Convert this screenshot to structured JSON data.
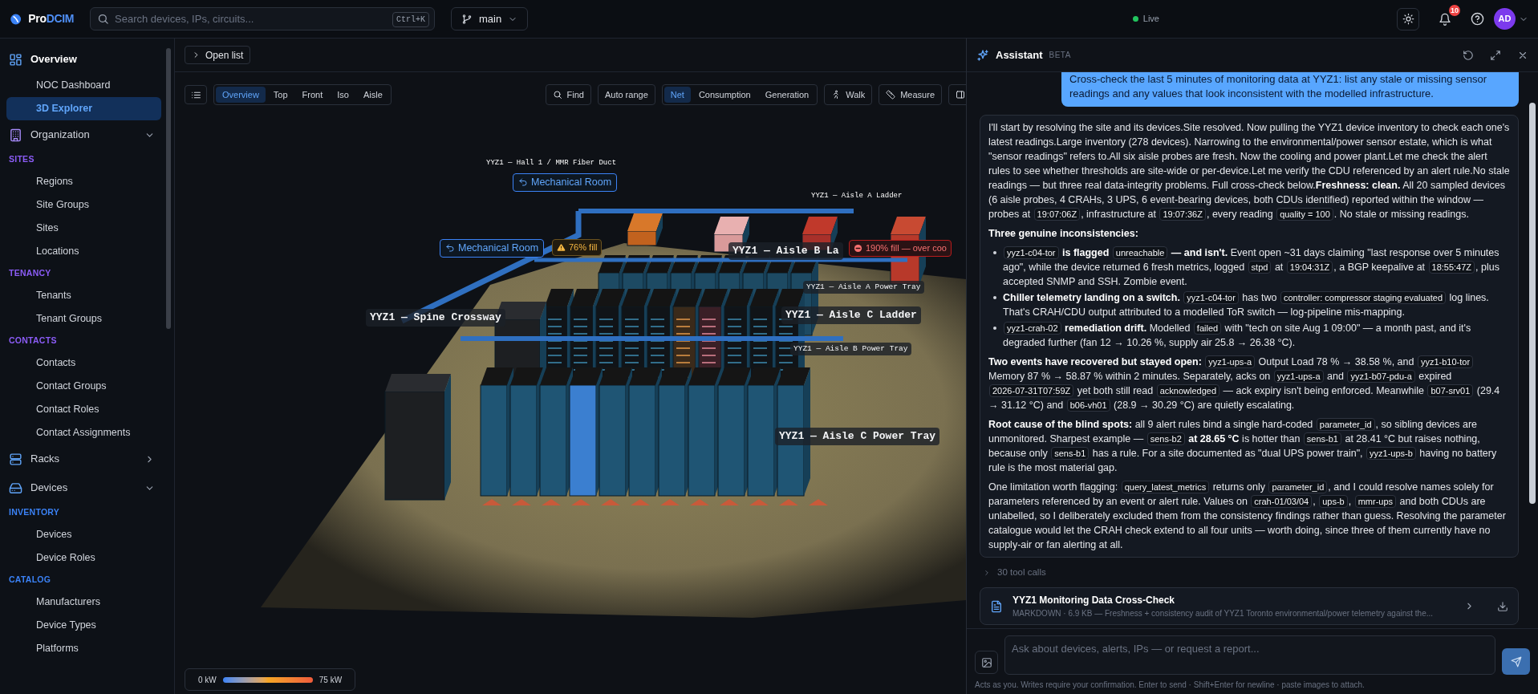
{
  "topbar": {
    "brand": {
      "first": "Pro",
      "second": "DCIM"
    },
    "search": {
      "placeholder": "Search devices, IPs, circuits...",
      "shortcut": "Ctrl+K"
    },
    "branch": "main",
    "live": "Live",
    "notifications": "10",
    "avatar": "AD"
  },
  "sidebar": {
    "sections": [
      {
        "label": "Overview",
        "selected": true,
        "items": [
          {
            "label": "NOC Dashboard",
            "selected": false
          },
          {
            "label": "3D Explorer",
            "selected": true
          }
        ]
      },
      {
        "label": "Organization",
        "selected": false,
        "expanded": true,
        "groups": [
          {
            "label": "SITES",
            "color": "#8b5cf6",
            "items": [
              {
                "label": "Regions",
                "selected": false
              },
              {
                "label": "Site Groups",
                "selected": false
              },
              {
                "label": "Sites",
                "selected": false
              },
              {
                "label": "Locations",
                "selected": false
              }
            ]
          },
          {
            "label": "TENANCY",
            "color": "#8b5cf6",
            "items": [
              {
                "label": "Tenants",
                "selected": false
              },
              {
                "label": "Tenant Groups",
                "selected": false
              }
            ]
          },
          {
            "label": "CONTACTS",
            "color": "#8b5cf6",
            "items": [
              {
                "label": "Contacts",
                "selected": false
              },
              {
                "label": "Contact Groups",
                "selected": false
              },
              {
                "label": "Contact Roles",
                "selected": false
              },
              {
                "label": "Contact Assignments",
                "selected": false
              }
            ]
          }
        ]
      },
      {
        "label": "Racks",
        "selected": false,
        "expanded": false
      },
      {
        "label": "Devices",
        "selected": false,
        "expanded": true,
        "groups": [
          {
            "label": "INVENTORY",
            "color": "#3b82f6",
            "items": [
              {
                "label": "Devices",
                "selected": false
              },
              {
                "label": "Device Roles",
                "selected": false
              }
            ]
          },
          {
            "label": "CATALOG",
            "color": "#3b82f6",
            "items": [
              {
                "label": "Manufacturers",
                "selected": false
              },
              {
                "label": "Device Types",
                "selected": false
              },
              {
                "label": "Platforms",
                "selected": false
              }
            ]
          }
        ]
      }
    ]
  },
  "toolbar": {
    "open_list": "Open list",
    "views": [
      {
        "label": "Overview",
        "selected": true
      },
      {
        "label": "Top",
        "selected": false
      },
      {
        "label": "Front",
        "selected": false
      },
      {
        "label": "Iso",
        "selected": false
      },
      {
        "label": "Aisle",
        "selected": false
      }
    ],
    "find": "Find",
    "auto_range": "Auto range",
    "modes": [
      {
        "label": "Net",
        "selected": true
      },
      {
        "label": "Consumption",
        "selected": false
      },
      {
        "label": "Generation",
        "selected": false
      }
    ],
    "walk": "Walk",
    "measure": "Measure"
  },
  "scene": {
    "labels": [
      {
        "kind": "caption",
        "text": "YYZ1 — Hall 1 / MMR Fiber Duct"
      },
      {
        "kind": "chip",
        "text": "Mechanical Room"
      },
      {
        "kind": "caption",
        "text": "YYZ1 — Aisle A Ladder"
      },
      {
        "kind": "chip",
        "text": "Mechanical Room"
      },
      {
        "kind": "warning",
        "text": "76% fill"
      },
      {
        "kind": "tag",
        "text": "YYZ1 — Aisle B La"
      },
      {
        "kind": "alert",
        "text": "190% fill — over coo"
      },
      {
        "kind": "small_tag",
        "text": "YYZ1 — Aisle A Power Tray"
      },
      {
        "kind": "tag",
        "text": "YYZ1 — Spine Crossway"
      },
      {
        "kind": "tag",
        "text": "YYZ1 — Aisle C Ladder"
      },
      {
        "kind": "small_tag",
        "text": "YYZ1 — Aisle B Power Tray"
      },
      {
        "kind": "tag",
        "text": "YYZ1 — Aisle C Power Tray"
      }
    ],
    "legend": {
      "min": "0 kW",
      "max": "75 kW"
    }
  },
  "assistant": {
    "title": "Assistant",
    "badge": "BETA",
    "user_message": "Cross-check the last 5 minutes of monitoring data at YYZ1: list any stale or missing sensor readings and any values that look inconsistent with the modelled infrastructure.",
    "reply": [
      {
        "kind": "paragraph",
        "segments": [
          {
            "kind": "text",
            "text": "I'll start by resolving the site and its devices.Site resolved. Now pulling the YYZ1 device inventory to check each one's latest readings.Large inventory (278 devices). Narrowing to the environmental/power sensor estate, which is what \"sensor readings\" refers to.All six aisle probes are fresh. Now the cooling and power plant.Let me check the alert rules to see whether thresholds are site-wide or per-device.Let me verify the CDU referenced by an alert rule.No stale readings — but three real data-integrity problems. Full cross-check below."
          },
          {
            "kind": "bold",
            "text": "Freshness: clean."
          },
          {
            "kind": "text",
            "text": " All 20 sampled devices (6 aisle probes, 4 CRAHs, 3 UPS, 6 event-bearing devices, both CDUs identified) reported within the window — probes at "
          },
          {
            "kind": "code",
            "text": "19:07:06Z"
          },
          {
            "kind": "text",
            "text": ", infrastructure at "
          },
          {
            "kind": "code",
            "text": "19:07:36Z"
          },
          {
            "kind": "text",
            "text": ", every reading "
          },
          {
            "kind": "code",
            "text": "quality = 100"
          },
          {
            "kind": "text",
            "text": ". No stale or missing readings."
          }
        ]
      },
      {
        "kind": "paragraph",
        "segments": [
          {
            "kind": "bold",
            "text": "Three genuine inconsistencies:"
          }
        ]
      },
      {
        "kind": "list",
        "items": [
          [
            {
              "kind": "code",
              "text": "yyz1-c04-tor"
            },
            {
              "kind": "bold",
              "text": " is flagged "
            },
            {
              "kind": "code",
              "text": "unreachable"
            },
            {
              "kind": "bold",
              "text": " — and isn't."
            },
            {
              "kind": "text",
              "text": " Event open ~31 days claiming \"last response over 5 minutes ago\", while the device returned 6 fresh metrics, logged "
            },
            {
              "kind": "code",
              "text": "stpd"
            },
            {
              "kind": "text",
              "text": " at "
            },
            {
              "kind": "code",
              "text": "19:04:31Z"
            },
            {
              "kind": "text",
              "text": ", a BGP keepalive at "
            },
            {
              "kind": "code",
              "text": "18:55:47Z"
            },
            {
              "kind": "text",
              "text": ", plus accepted SNMP and SSH. Zombie event."
            }
          ],
          [
            {
              "kind": "bold",
              "text": "Chiller telemetry landing on a switch. "
            },
            {
              "kind": "code",
              "text": "yyz1-c04-tor"
            },
            {
              "kind": "text",
              "text": " has two "
            },
            {
              "kind": "code",
              "text": "controller: compressor staging evaluated"
            },
            {
              "kind": "text",
              "text": " log lines. That's CRAH/CDU output attributed to a modelled ToR switch — log-pipeline mis-mapping."
            }
          ],
          [
            {
              "kind": "code",
              "text": "yyz1-crah-02"
            },
            {
              "kind": "bold",
              "text": " remediation drift."
            },
            {
              "kind": "text",
              "text": " Modelled "
            },
            {
              "kind": "code",
              "text": "failed"
            },
            {
              "kind": "text",
              "text": " with \"tech on site Aug 1 09:00\" — a month past, and it's degraded further (fan 12 → 10.26 %, supply air 25.8 → 26.38 °C)."
            }
          ]
        ]
      },
      {
        "kind": "paragraph",
        "segments": [
          {
            "kind": "bold",
            "text": "Two events have recovered but stayed open: "
          },
          {
            "kind": "code",
            "text": "yyz1-ups-a"
          },
          {
            "kind": "text",
            "text": " Output Load 78 % → 38.58 %, and "
          },
          {
            "kind": "code",
            "text": "yyz1-b10-tor"
          },
          {
            "kind": "text",
            "text": " Memory 87 % → 58.87 % within 2 minutes. Separately, acks on "
          },
          {
            "kind": "code",
            "text": "yyz1-ups-a"
          },
          {
            "kind": "text",
            "text": " and "
          },
          {
            "kind": "code",
            "text": "yyz1-b07-pdu-a"
          },
          {
            "kind": "text",
            "text": " expired "
          },
          {
            "kind": "code",
            "text": "2026-07-31T07:59Z"
          },
          {
            "kind": "text",
            "text": " yet both still read "
          },
          {
            "kind": "code",
            "text": "acknowledged"
          },
          {
            "kind": "text",
            "text": " — ack expiry isn't being enforced. Meanwhile "
          },
          {
            "kind": "code",
            "text": "b07-srv01"
          },
          {
            "kind": "text",
            "text": " (29.4 → 31.12 °C) and "
          },
          {
            "kind": "code",
            "text": "b06-vh01"
          },
          {
            "kind": "text",
            "text": " (28.9 → 30.29 °C) are quietly escalating."
          }
        ]
      },
      {
        "kind": "paragraph",
        "segments": [
          {
            "kind": "bold",
            "text": "Root cause of the blind spots:"
          },
          {
            "kind": "text",
            "text": " all 9 alert rules bind a single hard-coded "
          },
          {
            "kind": "code",
            "text": "parameter_id"
          },
          {
            "kind": "text",
            "text": ", so sibling devices are unmonitored. Sharpest example — "
          },
          {
            "kind": "code",
            "text": "sens-b2"
          },
          {
            "kind": "bold",
            "text": " at 28.65 °C"
          },
          {
            "kind": "text",
            "text": " is hotter than "
          },
          {
            "kind": "code",
            "text": "sens-b1"
          },
          {
            "kind": "text",
            "text": " at 28.41 °C but raises nothing, because only "
          },
          {
            "kind": "code",
            "text": "sens-b1"
          },
          {
            "kind": "text",
            "text": " has a rule. For a site documented as \"dual UPS power train\", "
          },
          {
            "kind": "code",
            "text": "yyz1-ups-b"
          },
          {
            "kind": "text",
            "text": " having no battery rule is the most material gap."
          }
        ]
      },
      {
        "kind": "paragraph",
        "segments": [
          {
            "kind": "text",
            "text": "One limitation worth flagging: "
          },
          {
            "kind": "code",
            "text": "query_latest_metrics"
          },
          {
            "kind": "text",
            "text": " returns only "
          },
          {
            "kind": "code",
            "text": "parameter_id"
          },
          {
            "kind": "text",
            "text": ", and I could resolve names solely for parameters referenced by an event or alert rule. Values on "
          },
          {
            "kind": "code",
            "text": "crah-01/03/04"
          },
          {
            "kind": "text",
            "text": ", "
          },
          {
            "kind": "code",
            "text": "ups-b"
          },
          {
            "kind": "text",
            "text": ", "
          },
          {
            "kind": "code",
            "text": "mmr-ups"
          },
          {
            "kind": "text",
            "text": " and both CDUs are unlabelled, so I deliberately excluded them from the consistency findings rather than guess. Resolving the parameter catalogue would let the CRAH check extend to all four units — worth doing, since three of them currently have no supply-air or fan alerting at all."
          }
        ]
      }
    ],
    "tool_calls": "30 tool calls",
    "attachment": {
      "title": "YYZ1 Monitoring Data Cross-Check",
      "meta": "MARKDOWN · 6.9 KB — Freshness + consistency audit of YYZ1 Toronto environmental/power telemetry against the..."
    },
    "input": {
      "placeholder": "Ask about devices, alerts, IPs — or request a report..."
    },
    "footer": "Acts as you. Writes require your confirmation. Enter to send · Shift+Enter for newline · paste images to attach."
  }
}
